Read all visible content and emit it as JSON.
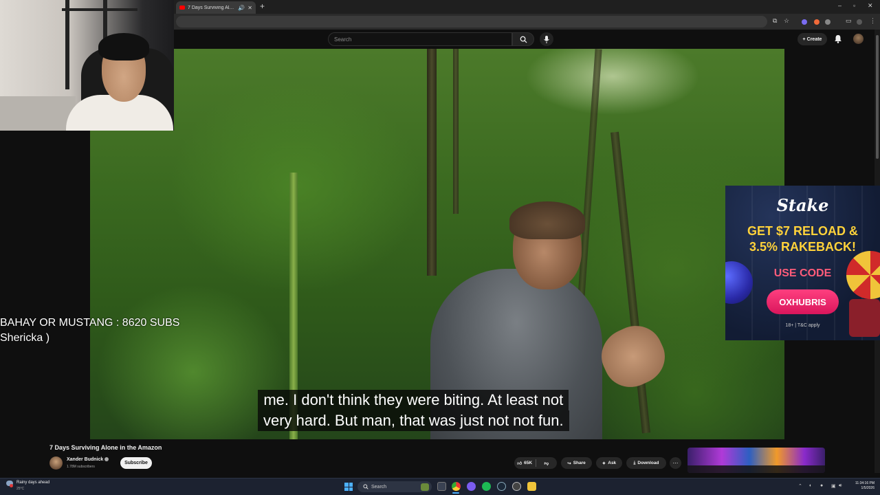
{
  "browser": {
    "tab_title": "7 Days Surviving Alone in the Amazon",
    "new_tab_glyph": "+",
    "window_controls": [
      "–",
      "▫",
      "✕"
    ]
  },
  "youtube_header": {
    "search_placeholder": "Search",
    "create_label": "Create"
  },
  "video": {
    "subtitle_line1": "me. I don't think they were biting. At least not",
    "subtitle_line2": "very hard. But man, that was just not not fun."
  },
  "stream_overlay": {
    "line1": "BAHAY OR MUSTANG : 8620 SUBS",
    "line2": "Shericka )"
  },
  "ad": {
    "brand": "Stake",
    "headline_line1": "GET $7 RELOAD &",
    "headline_line2": "3.5% RAKEBACK!",
    "use_code": "USE CODE",
    "code": "OXHUBRIS",
    "terms": "18+ | T&C apply"
  },
  "video_info": {
    "title": "7 Days Surviving Alone in the Amazon",
    "channel_name": "Xander Budnick",
    "subscriber_count": "1.78M subscribers",
    "subscribe_label": "Subscribe",
    "like_count": "65K",
    "share_label": "Share",
    "ask_label": "Ask",
    "download_label": "Download"
  },
  "taskbar": {
    "weather_title": "Rainy days ahead",
    "weather_temp": "25°C",
    "search_label": "Search",
    "time": "11:34:16 PM",
    "date": "1/5/2026"
  },
  "colors": {
    "youtube_red": "#ff0000",
    "ad_headline": "#ffd23a",
    "ad_button": "#e0266a",
    "windows_accent": "#4cb0ff"
  }
}
